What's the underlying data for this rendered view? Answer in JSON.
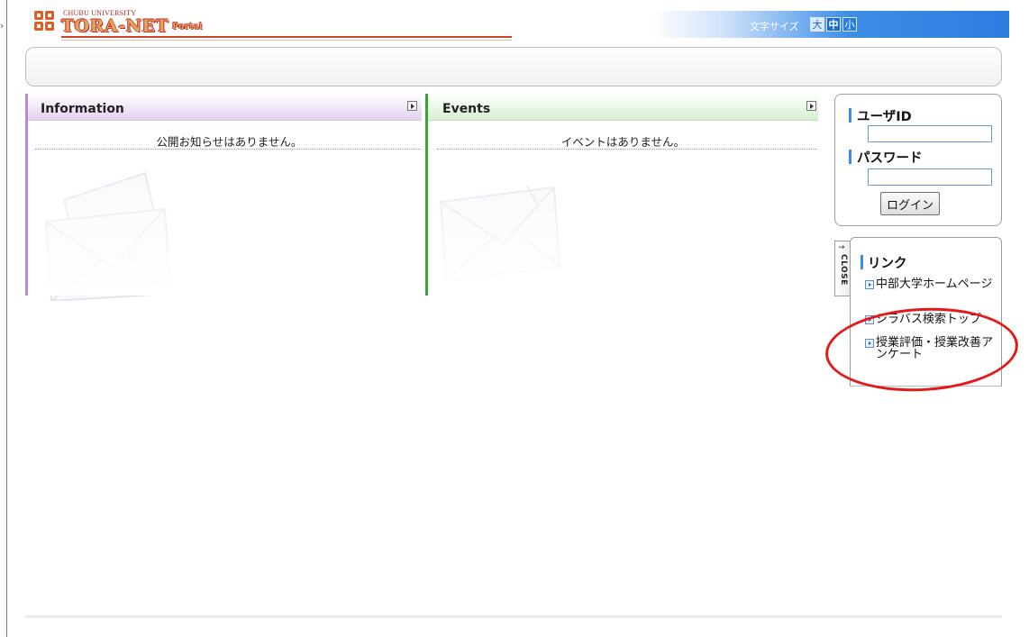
{
  "header": {
    "logo_university": "CHUBU UNIVERSITY",
    "logo_main": "TORA-NET",
    "logo_sub": "Portal",
    "font_size_label": "文字サイズ",
    "font_size_options": [
      "大",
      "中",
      "小"
    ],
    "font_size_selected": "中"
  },
  "panels": {
    "information": {
      "title": "Information",
      "message": "公開お知らせはありません。",
      "accent_color": "#b88bd6"
    },
    "events": {
      "title": "Events",
      "message": "イベントはありません。",
      "accent_color": "#3aa33a"
    }
  },
  "login": {
    "user_id_label": "ユーザID",
    "user_id_value": "",
    "password_label": "パスワード",
    "password_value": "",
    "login_button": "ログイン"
  },
  "links": {
    "close_tab_label": "CLOSE",
    "close_tab_arrow": "→",
    "title": "リンク",
    "items": [
      "中部大学ホームページ",
      "シラバス検索トップ",
      "授業評価・授業改善アンケート"
    ]
  },
  "colors": {
    "accent_blue": "#3d8ee8",
    "highlight_red": "#e41a1a"
  }
}
